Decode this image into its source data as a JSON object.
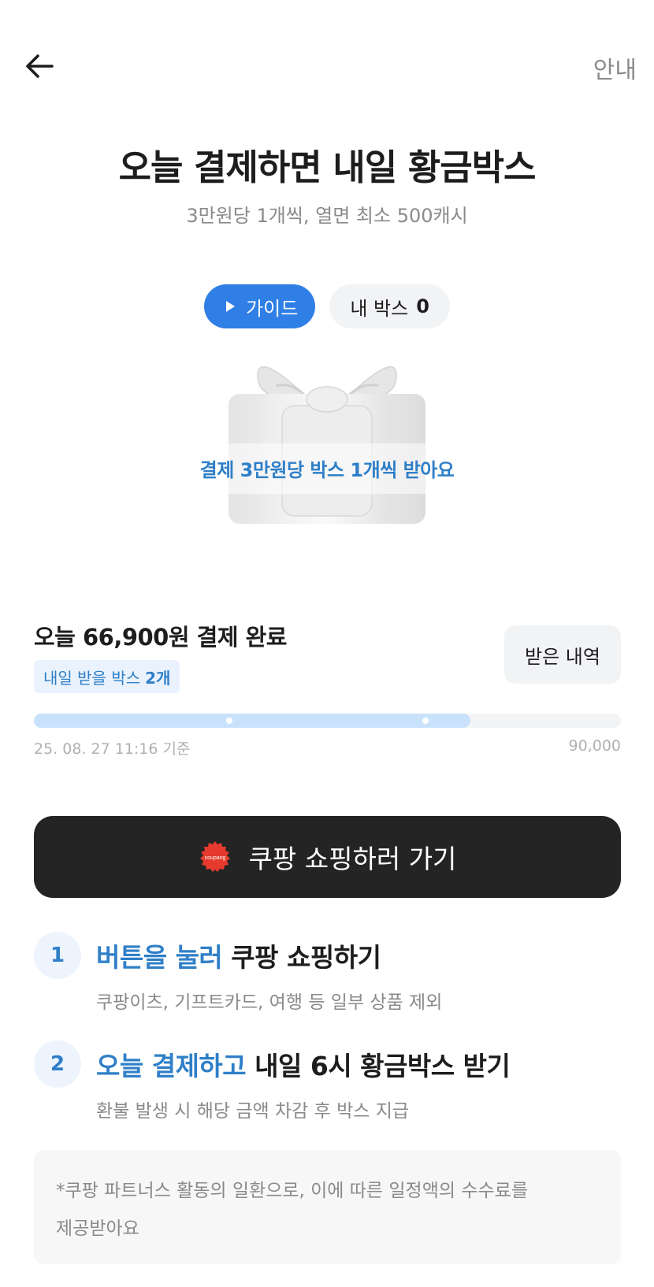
{
  "header": {
    "guide_link": "안내"
  },
  "hero": {
    "title": "오늘 결제하면 내일 황금박스",
    "subtitle": "3만원당 1개씩, 열면 최소 500캐시",
    "guide_button": "가이드",
    "mybox_label": "내 박스",
    "mybox_count": "0",
    "gift_caption": "결제 3만원당 박스 1개씩 받아요"
  },
  "status": {
    "paid_text": "오늘 66,900원 결제 완료",
    "tomorrow_label": "내일 받을 박스",
    "tomorrow_count": "2개",
    "history_button": "받은 내역",
    "progress_value": 66900,
    "progress_max": 90000,
    "progress_milestones": [
      30000,
      60000
    ],
    "date_text": "25. 08. 27 11:16 기준",
    "max_text": "90,000"
  },
  "cta": {
    "label": "쿠팡 쇼핑하러 가기",
    "logo_text": "coupang"
  },
  "steps": [
    {
      "num": "1",
      "highlight": "버튼을 눌러",
      "rest": "쿠팡 쇼핑하기",
      "desc": "쿠팡이츠, 기프트카드, 여행 등 일부 상품 제외"
    },
    {
      "num": "2",
      "highlight": "오늘 결제하고",
      "rest": "내일 6시 황금박스 받기",
      "desc": "환불 발생 시 해당 금액 차감 후 박스 지급"
    }
  ],
  "notice": {
    "line1": "*쿠팡 파트너스 활동의 일환으로, 이에 따른 일정액의 수수료를",
    "line2": "제공받아요"
  },
  "colors": {
    "accent": "#2f7fe6",
    "accent_text": "#2f7fc8",
    "cta_bg": "#242424",
    "progress_fill": "#c9e2fb"
  }
}
